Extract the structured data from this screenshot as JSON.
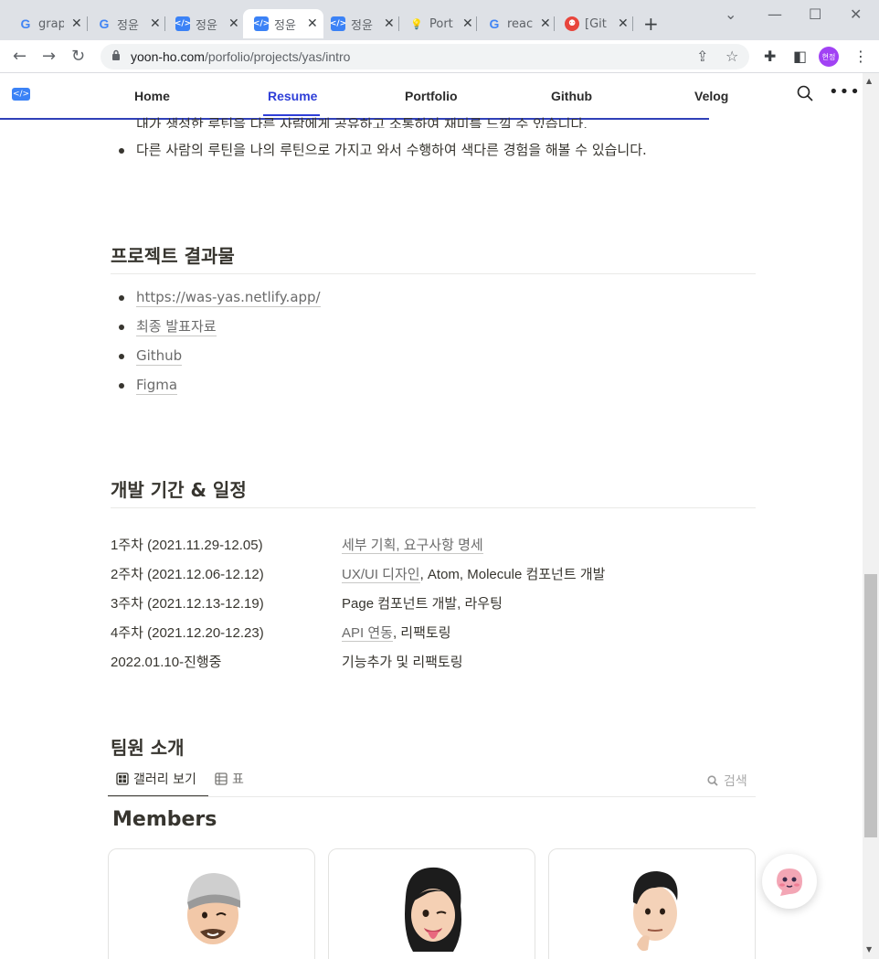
{
  "browser": {
    "tabs": [
      {
        "icon": "google-icon",
        "title": "grap",
        "active": false
      },
      {
        "icon": "google-icon",
        "title": "정윤",
        "active": false
      },
      {
        "icon": "code-icon",
        "title": "정윤",
        "active": false
      },
      {
        "icon": "code-icon",
        "title": "정윤",
        "active": true
      },
      {
        "icon": "code-icon",
        "title": "정윤",
        "active": false
      },
      {
        "icon": "bulb-icon",
        "title": "Port",
        "active": false
      },
      {
        "icon": "google-icon",
        "title": "reac",
        "active": false
      },
      {
        "icon": "github-icon",
        "title": "[Git",
        "active": false
      }
    ],
    "url_host": "yoon-ho.com",
    "url_path": "/porfolio/projects/yas/intro",
    "profile_initials": "현정"
  },
  "site": {
    "nav": [
      {
        "label": "Home",
        "active": false
      },
      {
        "label": "Resume",
        "active": true
      },
      {
        "label": "Portfolio",
        "active": false
      },
      {
        "label": "Github",
        "active": false
      },
      {
        "label": "Velog",
        "active": false
      }
    ],
    "accent_color": "#2f3fd8"
  },
  "page": {
    "cut_bullet": "내가 생성한 루틴을 다른 사람에게 공유하고 소통하여 재미를 느낄 수 있습니다.",
    "bullet": "다른 사람의 루틴을 나의 루틴으로 가지고 와서 수행하여 색다른 경험을 해볼 수 있습니다.",
    "results_heading": "프로젝트 결과물",
    "results_links": [
      "https://was-yas.netlify.app/",
      "최종 발표자료",
      "Github",
      "Figma"
    ],
    "schedule_heading": "개발 기간 & 일정",
    "schedule": [
      {
        "period": "1주차 (2021.11.29-12.05)",
        "link": "세부 기획, 요구사항 명세",
        "rest": ""
      },
      {
        "period": "2주차 (2021.12.06-12.12)",
        "link": "UX/UI 디자인",
        "rest": ", Atom, Molecule 컴포넌트 개발"
      },
      {
        "period": "3주차 (2021.12.13-12.19)",
        "link": "",
        "rest": "Page 컴포넌트 개발, 라우팅"
      },
      {
        "period": "4주차 (2021.12.20-12.23)",
        "link": "API 연동",
        "rest": ", 리팩토링"
      },
      {
        "period": "2022.01.10-진행중",
        "link": "",
        "rest": "기능추가 및 리팩토링"
      }
    ],
    "team_heading": "팀원 소개",
    "view_tabs": [
      "갤러리 보기",
      "표"
    ],
    "search_placeholder": "검색",
    "gallery_title": "Members"
  }
}
